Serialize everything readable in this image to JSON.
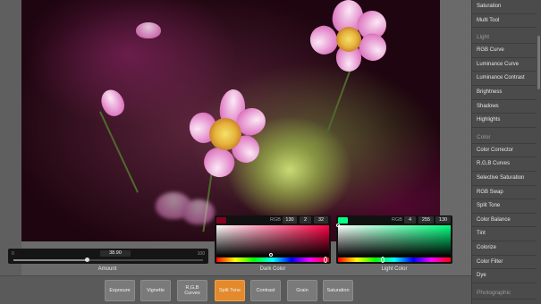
{
  "sidebar": {
    "items_top": [
      "Saturation",
      "Multi Tool"
    ],
    "section_light": "Light",
    "items_light": [
      "RGB Curve",
      "Luminance Curve",
      "Luminance Contrast",
      "Brightness",
      "Shadows",
      "Highlights"
    ],
    "section_color": "Color",
    "items_color": [
      "Color Corrector",
      "R,G,B Curves",
      "Selective Saturation",
      "RGB Swap",
      "Split Tone",
      "Color Balance",
      "Tint",
      "Colorize",
      "Color Filter",
      "Dye"
    ],
    "section_photographic": "Photographic"
  },
  "amount": {
    "min": "0",
    "max": "100",
    "value": "38.90",
    "fraction": 0.389,
    "label": "Amount"
  },
  "dark_color": {
    "label": "Dark Color",
    "rgb_label": "RGB",
    "r": "130",
    "g": "2",
    "b": "32",
    "swatch": "#820220"
  },
  "light_color": {
    "label": "Light Color",
    "rgb_label": "RGB",
    "r": "4",
    "g": "255",
    "b": "130",
    "swatch": "#04ff82"
  },
  "toolbar": {
    "buttons": [
      "Exposure",
      "Vignette",
      "R,G,B Curves",
      "Split Tone",
      "Contrast",
      "Grain",
      "Saturation"
    ],
    "active": "Split Tone"
  },
  "colors": {
    "accent": "#e38a2c"
  }
}
